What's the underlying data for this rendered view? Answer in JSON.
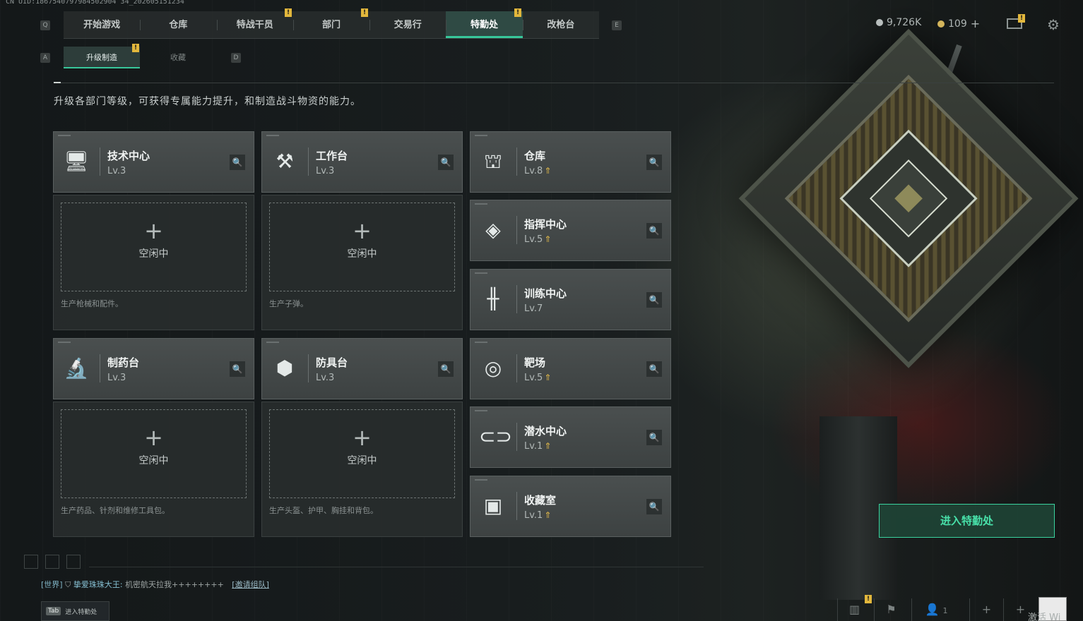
{
  "uid": "CN UID:1867540797984502904 34_202605151234",
  "top_tabs": [
    {
      "label": "开始游戏",
      "active": false
    },
    {
      "label": "仓库",
      "active": false
    },
    {
      "label": "特战干员",
      "active": false
    },
    {
      "label": "部门",
      "active": false
    },
    {
      "label": "交易行",
      "active": false
    },
    {
      "label": "特勤处",
      "active": true
    },
    {
      "label": "改枪台",
      "active": false
    }
  ],
  "keys": {
    "q": "Q",
    "e": "E",
    "a": "A",
    "d": "D"
  },
  "badge_mark": "!",
  "currency": {
    "silver": "9,726K",
    "gold": "109",
    "gold_plus": "+"
  },
  "sub_tabs": [
    {
      "label": "升级制造",
      "active": true
    },
    {
      "label": "收藏",
      "active": false
    }
  ],
  "description": "升级各部门等级，可获得专属能力提升，和制造战斗物资的能力。",
  "production": [
    {
      "name": "技术中心",
      "level": "Lv.3",
      "icon": "computer-icon",
      "idle_label": "空闲中",
      "produces": "生产枪械和配件。"
    },
    {
      "name": "工作台",
      "level": "Lv.3",
      "icon": "hammer-icon",
      "idle_label": "空闲中",
      "produces": "生产子弹。"
    },
    {
      "name": "制药台",
      "level": "Lv.3",
      "icon": "microscope-icon",
      "idle_label": "空闲中",
      "produces": "生产药品、针剂和维修工具包。"
    },
    {
      "name": "防具台",
      "level": "Lv.3",
      "icon": "cubes-icon",
      "idle_label": "空闲中",
      "produces": "生产头盔、护甲、胸挂和背包。"
    }
  ],
  "facilities": [
    {
      "name": "仓库",
      "level": "Lv.8",
      "icon": "vault-icon",
      "upgradeable": true
    },
    {
      "name": "指挥中心",
      "level": "Lv.5",
      "icon": "chip-icon",
      "upgradeable": true
    },
    {
      "name": "训练中心",
      "level": "Lv.7",
      "icon": "dumbbell-icon",
      "upgradeable": false
    },
    {
      "name": "靶场",
      "level": "Lv.5",
      "icon": "target-icon",
      "upgradeable": true
    },
    {
      "name": "潜水中心",
      "level": "Lv.1",
      "icon": "diving-mask-icon",
      "upgradeable": true
    },
    {
      "name": "收藏室",
      "level": "Lv.1",
      "icon": "display-case-icon",
      "upgradeable": true
    }
  ],
  "enter_button": "进入特勤处",
  "chat": {
    "channel": "[世界]",
    "user": "挚爱珠珠大王:",
    "message": "机密航天拉我++++++++",
    "invite": "[邀请组队]"
  },
  "tab_hint": {
    "key": "Tab",
    "label": "进入特勤处"
  },
  "bottom": {
    "squad_count": "1"
  },
  "watermark": "激活 Wi",
  "colors": {
    "accent": "#37c79a",
    "warning": "#e2b73c",
    "upgrade": "#e0b84a"
  }
}
